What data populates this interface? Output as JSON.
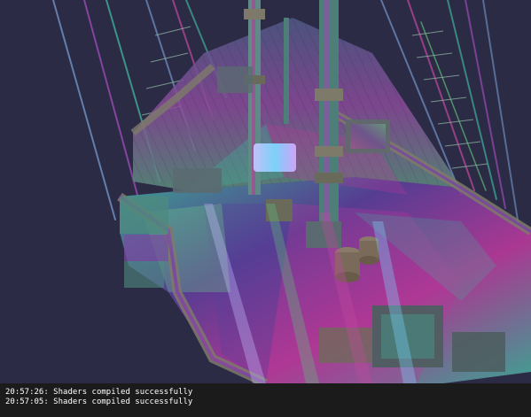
{
  "viewport": {
    "background_color": "#2c2b45",
    "scene": "ship model rendered with debug normal shading",
    "palette": {
      "teal": "#3fae9a",
      "magenta": "#b8399b",
      "purple": "#5a3f9a",
      "green": "#5fbf7a",
      "wood": "#6f6a5a",
      "lavender": "#c7c2ff"
    }
  },
  "console": {
    "background_color": "#1b1b1b",
    "text_color": "#ffffff",
    "lines": [
      "20:57:26: Shaders compiled successfully",
      "20:57:05: Shaders compiled successfully"
    ]
  }
}
